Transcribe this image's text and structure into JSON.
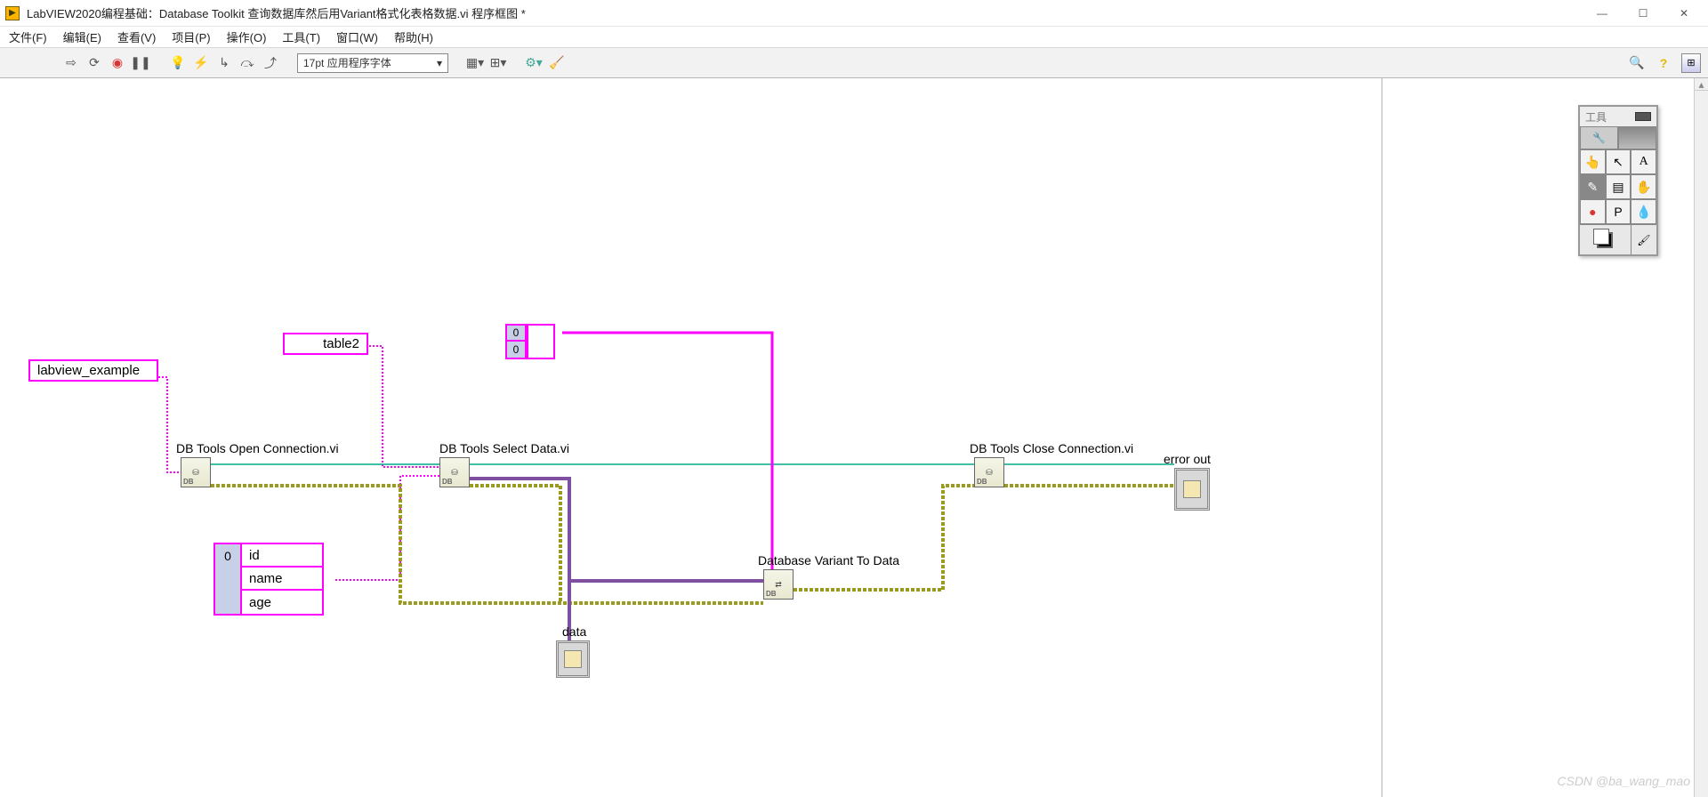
{
  "window": {
    "title": "LabVIEW2020编程基础：Database Toolkit 查询数据库然后用Variant格式化表格数据.vi 程序框图 *"
  },
  "menu": {
    "file": "文件(F)",
    "edit": "编辑(E)",
    "view": "查看(V)",
    "project": "项目(P)",
    "operate": "操作(O)",
    "tools": "工具(T)",
    "window": "窗口(W)",
    "help": "帮助(H)"
  },
  "toolbar": {
    "font": "17pt 应用程序字体"
  },
  "tools_palette": {
    "title": "工具"
  },
  "diagram": {
    "dsn": "labview_example",
    "table": "table2",
    "columns_index": "0",
    "columns": [
      "id",
      "name",
      "age"
    ],
    "array2d_idx": [
      "0",
      "0"
    ],
    "node_open": "DB Tools Open Connection.vi",
    "node_select": "DB Tools Select Data.vi",
    "node_variant": "Database Variant To Data",
    "node_close": "DB Tools Close Connection.vi",
    "error_out": "error out",
    "data": "data"
  },
  "watermark": "CSDN @ba_wang_mao"
}
